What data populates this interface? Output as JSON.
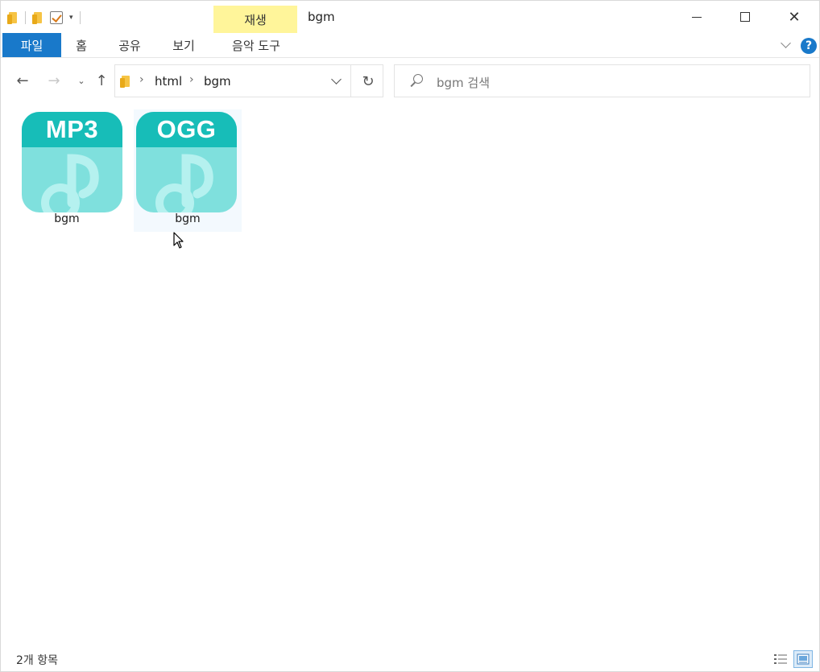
{
  "window": {
    "title": "bgm",
    "context_tab": "재생"
  },
  "ribbon": {
    "tabs": [
      {
        "label": "파일"
      },
      {
        "label": "홈"
      },
      {
        "label": "공유"
      },
      {
        "label": "보기"
      },
      {
        "label": "음악 도구"
      }
    ],
    "help_label": "?"
  },
  "address": {
    "crumbs": [
      {
        "label": "html"
      },
      {
        "label": "bgm"
      }
    ]
  },
  "search": {
    "placeholder": "bgm 검색"
  },
  "files": [
    {
      "name": "bgm",
      "extension": "MP3",
      "selected": false
    },
    {
      "name": "bgm",
      "extension": "OGG",
      "selected": true
    }
  ],
  "colors": {
    "accent": "#1979ca",
    "context_tab_bg": "#fff59a",
    "icon_band": "#17bdb8",
    "icon_body": "#7fe0dd"
  },
  "icons": {
    "back": "arrow-left-icon",
    "forward": "arrow-right-icon",
    "up": "arrow-up-icon",
    "refresh": "refresh-icon",
    "search": "search-icon",
    "help": "help-icon",
    "file_type": "music-note-icon"
  },
  "status": {
    "item_count": "2개 항목"
  }
}
